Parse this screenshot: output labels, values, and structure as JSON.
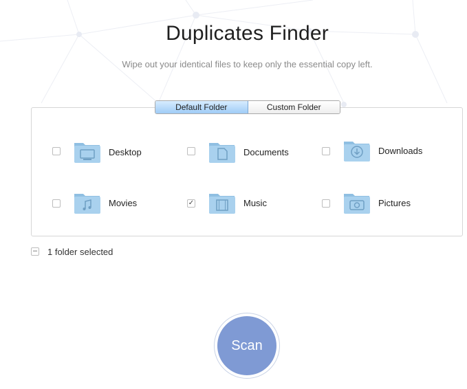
{
  "header": {
    "title": "Duplicates Finder",
    "subtitle": "Wipe out your identical files to keep only the essential copy left."
  },
  "tabs": [
    {
      "label": "Default Folder",
      "active": true
    },
    {
      "label": "Custom Folder",
      "active": false
    }
  ],
  "folders": [
    {
      "label": "Desktop",
      "checked": false,
      "icon": "desktop-folder-icon"
    },
    {
      "label": "Documents",
      "checked": false,
      "icon": "documents-folder-icon"
    },
    {
      "label": "Downloads",
      "checked": false,
      "icon": "downloads-folder-icon"
    },
    {
      "label": "Movies",
      "checked": false,
      "icon": "movies-folder-icon"
    },
    {
      "label": "Music",
      "checked": true,
      "icon": "music-folder-icon"
    },
    {
      "label": "Pictures",
      "checked": false,
      "icon": "pictures-folder-icon"
    }
  ],
  "status": {
    "text": "1 folder selected"
  },
  "scan": {
    "label": "Scan"
  },
  "colors": {
    "accent": "#7f9ad4",
    "folder": "#9ec8e6",
    "tab_active": "#b8dafb"
  }
}
